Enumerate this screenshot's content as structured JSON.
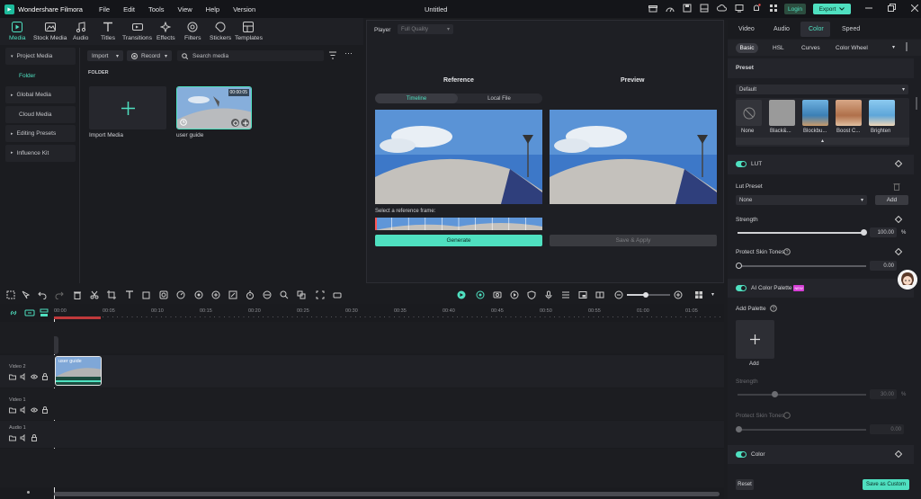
{
  "app": {
    "name": "Wondershare Filmora",
    "doc_title": "Untitled"
  },
  "menu": [
    "File",
    "Edit",
    "Tools",
    "View",
    "Help",
    "Version"
  ],
  "topright": {
    "login": "Login",
    "export": "Export"
  },
  "toolbar": [
    {
      "label": "Media",
      "icon": "media-icon",
      "active": true
    },
    {
      "label": "Stock Media",
      "icon": "stock-media-icon"
    },
    {
      "label": "Audio",
      "icon": "audio-icon"
    },
    {
      "label": "Titles",
      "icon": "titles-icon"
    },
    {
      "label": "Transitions",
      "icon": "transitions-icon"
    },
    {
      "label": "Effects",
      "icon": "effects-icon"
    },
    {
      "label": "Filters",
      "icon": "filters-icon"
    },
    {
      "label": "Stickers",
      "icon": "stickers-icon"
    },
    {
      "label": "Templates",
      "icon": "templates-icon"
    }
  ],
  "leftnav": {
    "items": [
      "Project Media",
      "Folder",
      "Global Media",
      "Cloud Media",
      "Editing Presets",
      "Influence Kit"
    ]
  },
  "media": {
    "import": "Import",
    "record": "Record",
    "search_placeholder": "Search media",
    "folder_label": "FOLDER",
    "import_media": "Import Media",
    "clip_name": "user guide",
    "clip_duration": "00:00:05"
  },
  "player": {
    "label": "Player",
    "quality": "Full Quality",
    "reference": "Reference",
    "preview": "Preview",
    "tab_timeline": "Timeline",
    "tab_local": "Local File",
    "select_frame": "Select a reference frame:",
    "generate": "Generate",
    "save_apply": "Save & Apply"
  },
  "right": {
    "tabs": [
      "Video",
      "Audio",
      "Color",
      "Speed"
    ],
    "active_tab": "Color",
    "subtabs": [
      "Basic",
      "HSL",
      "Curves",
      "Color Wheel"
    ],
    "preset_title": "Preset",
    "preset_select": "Default",
    "presets": [
      "None",
      "Black&...",
      "Blockbu...",
      "Boost C...",
      "Brighten"
    ],
    "lut": "LUT",
    "lut_preset": "Lut Preset",
    "lut_value": "None",
    "add": "Add",
    "strength": "Strength",
    "strength_value": "100.00",
    "percent": "%",
    "protect_skin": "Protect Skin Tones",
    "protect_value": "0.00",
    "ai_palette": "AI Color Palette",
    "new_badge": "NEW",
    "add_palette": "Add Palette",
    "add_small": "Add",
    "strength2": "Strength",
    "strength2_value": "30.00",
    "protect2": "Protect Skin Tones",
    "protect2_value": "0.00",
    "color": "Color",
    "reset": "Reset",
    "save_custom": "Save as Custom"
  },
  "timeline": {
    "ticks": [
      "00:00",
      "00:05",
      "00:10",
      "00:15",
      "00:20",
      "00:25",
      "00:30",
      "00:35",
      "00:40",
      "00:45",
      "00:50",
      "00:55",
      "01:00",
      "01:05"
    ],
    "tracks": [
      "Video 2",
      "Video 1",
      "Audio 1"
    ],
    "clip_label": "user guide"
  },
  "colors": {
    "accent": "#4fe0c0",
    "bg": "#1b1c20",
    "panel": "#24252b"
  }
}
